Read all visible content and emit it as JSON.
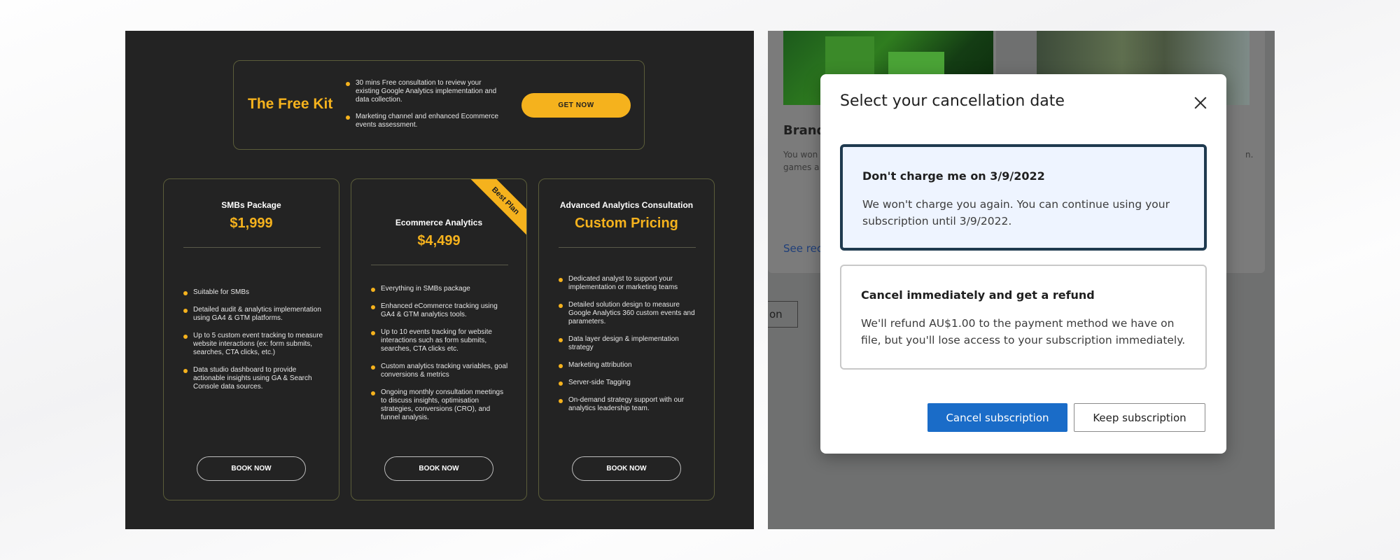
{
  "colors": {
    "accent": "#f5b21d",
    "dark_bg": "#232323",
    "primary_blue": "#1a6cc8",
    "selected_option_bg": "#eef4ff"
  },
  "left": {
    "free_kit": {
      "title": "The Free Kit",
      "bullets": [
        "30 mins Free consultation to review your existing Google Analytics implementation and data collection.",
        "Marketing channel and enhanced Ecommerce events assessment."
      ],
      "cta": "GET NOW"
    },
    "cards": [
      {
        "title": "SMBs Package",
        "price": "$1,999",
        "features": [
          "Suitable for SMBs",
          "Detailed audit & analytics implementation using GA4 & GTM platforms.",
          "Up to 5 custom event tracking to measure website interactions (ex: form submits, searches, CTA clicks, etc.)",
          "Data studio dashboard to provide actionable insights using GA & Search Console data sources."
        ],
        "cta": "BOOK NOW"
      },
      {
        "title": "Ecommerce Analytics",
        "price": "$4,499",
        "badge": "Best Plan",
        "features": [
          "Everything in SMBs package",
          "Enhanced eCommerce tracking using GA4 & GTM analytics tools.",
          "Up to 10 events tracking for website interactions such as form submits, searches, CTA clicks etc.",
          "Custom analytics tracking variables, goal conversions & metrics",
          "Ongoing monthly consultation meetings to discuss insights, optimisation strategies, conversions (CRO), and funnel analysis."
        ],
        "cta": "BOOK NOW"
      },
      {
        "title": "Advanced Analytics Consultation",
        "price": "Custom Pricing",
        "features": [
          "Dedicated analyst to support your implementation or marketing teams",
          "Detailed solution design to measure Google Analytics 360 custom events and parameters.",
          "Data layer design & implementation strategy",
          "Marketing attribution",
          "Server-side Tagging",
          "On-demand strategy support with our analytics leadership team."
        ],
        "cta": "BOOK NOW"
      }
    ]
  },
  "right": {
    "background": {
      "card_title": "Brand",
      "card_text": "You won games a",
      "link": "See rec",
      "trailing_text": "n.",
      "button_fragment": "on"
    },
    "modal": {
      "title": "Select your cancellation date",
      "options": [
        {
          "title": "Don't charge me on 3/9/2022",
          "description": "We won't charge you again. You can continue using your subscription until 3/9/2022.",
          "selected": true
        },
        {
          "title": "Cancel immediately and get a refund",
          "description": "We'll refund AU$1.00 to the payment method we have on file, but you'll lose access to your subscription immediately.",
          "selected": false
        }
      ],
      "primary_button": "Cancel subscription",
      "secondary_button": "Keep subscription"
    }
  }
}
